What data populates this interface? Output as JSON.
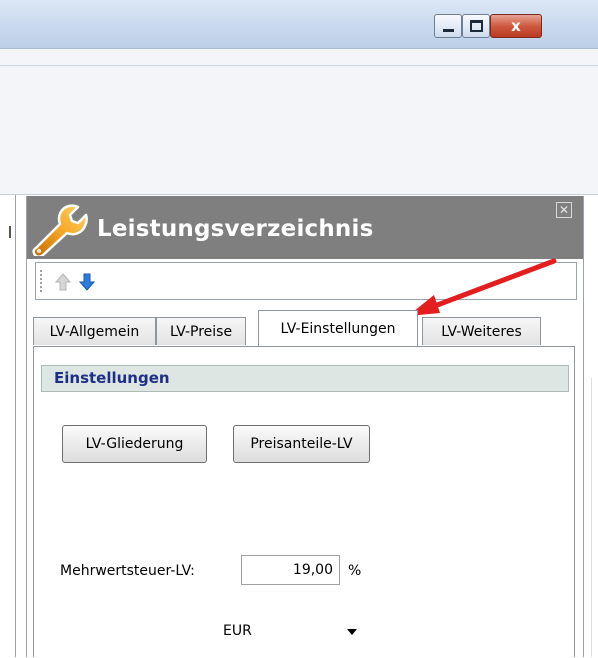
{
  "window": {
    "minimize_icon": "minimize-icon",
    "maximize_icon": "maximize-icon",
    "close_label": "x"
  },
  "panel": {
    "title": "Leistungsverzeichnis",
    "icon": "wrench-icon",
    "close_glyph": "✕",
    "toolbar": {
      "up_icon": "arrow-up-icon",
      "down_icon": "arrow-down-icon"
    },
    "tabs": [
      {
        "label": "LV-Allgemein"
      },
      {
        "label": "LV-Preise"
      },
      {
        "label": "LV-Einstellungen"
      },
      {
        "label": "LV-Weiteres"
      }
    ],
    "active_tab": "LV-Einstellungen"
  },
  "settings": {
    "section_title": "Einstellungen",
    "btn_gliederung": "LV-Gliederung",
    "btn_preisanteile": "Preisanteile-LV",
    "mwst_label": "Mehrwertsteuer-LV:",
    "mwst_value": "19,00",
    "mwst_unit": "%",
    "currency": "EUR"
  },
  "colors": {
    "panel_header": "#7f7f7f",
    "section_header_bg": "#dde6e3",
    "section_header_text": "#1f2f86",
    "annotation_arrow": "#e41e1e"
  }
}
